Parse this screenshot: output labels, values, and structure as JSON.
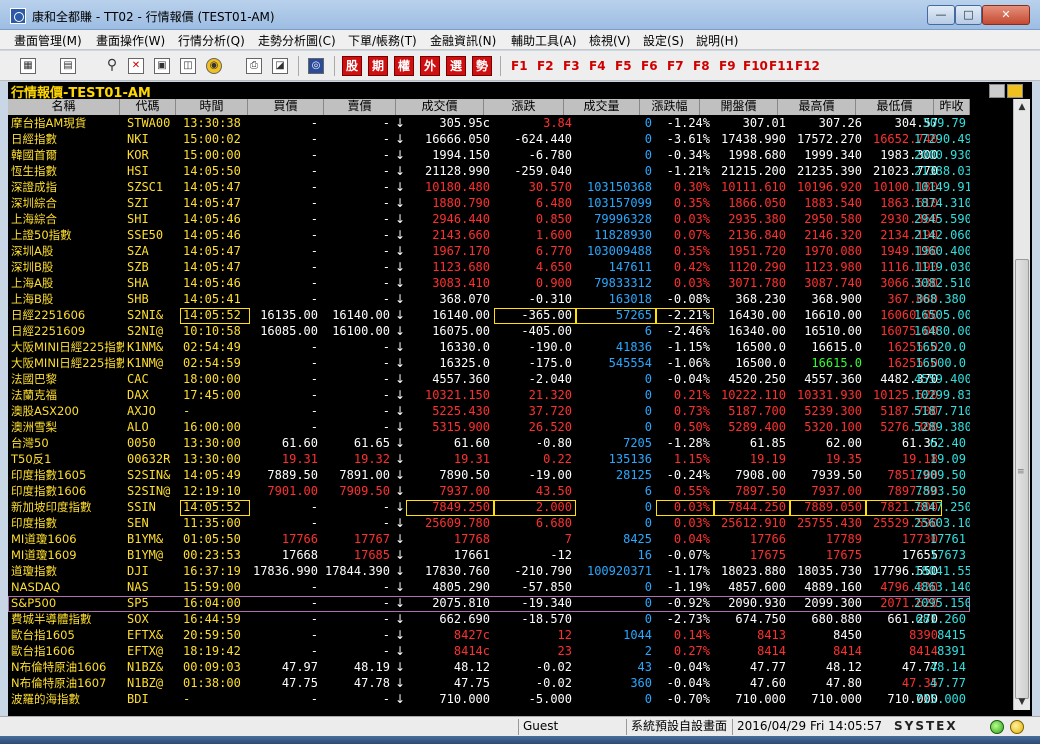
{
  "window": {
    "title": "康和全都賺 - TT02 - 行情報價 (TEST01-AM)",
    "min": "—",
    "max": "□",
    "close": "✕"
  },
  "menu": [
    "畫面管理(M)",
    "畫面操作(W)",
    "行情分析(Q)",
    "走勢分析圖(C)",
    "下單/帳務(T)",
    "金融資訊(N)",
    "輔助工具(A)",
    "檢視(V)",
    "設定(S)",
    "說明(H)"
  ],
  "toolbar": {
    "icons": [
      "layout-icon",
      "document-icon",
      "search-icon",
      "close-window-icon",
      "grid-icon",
      "news-icon",
      "globe-icon",
      "print-icon",
      "chart-icon",
      "logo-icon"
    ],
    "red_buttons": [
      "股",
      "期",
      "權",
      "外",
      "選",
      "勢"
    ],
    "fkeys": [
      "F1",
      "F2",
      "F3",
      "F4",
      "F5",
      "F6",
      "F7",
      "F8",
      "F9",
      "F10",
      "F11",
      "F12"
    ]
  },
  "panel": {
    "title": "行情報價-TEST01-AM"
  },
  "columns": [
    "名稱",
    "代碼",
    "時間",
    "買價",
    "賣價",
    "成交價",
    "漲跌",
    "成交量",
    "漲跌幅",
    "開盤價",
    "最高價",
    "最低價",
    "昨收"
  ],
  "rows": [
    [
      "摩台指AM現貨",
      "STWA00",
      "13:30:38",
      "-",
      "-",
      "305.95c",
      "3.84",
      "0",
      "-1.24%",
      "307.01",
      "307.26",
      "304.57",
      "309.79",
      "w",
      "r",
      "w",
      "w",
      "w",
      "c",
      "up"
    ],
    [
      "日經指數",
      "NKI",
      "15:00:02",
      "-",
      "-",
      "16666.050",
      "-624.440",
      "0",
      "-3.61%",
      "17438.990",
      "17572.270",
      "16652.740",
      "17290.490",
      "w",
      "w",
      "w",
      "w",
      "r",
      "c",
      "up"
    ],
    [
      "韓國首爾",
      "KOR",
      "15:00:00",
      "-",
      "-",
      "1994.150",
      "-6.780",
      "0",
      "-0.34%",
      "1998.680",
      "1999.340",
      "1983.300",
      "2000.930",
      "w",
      "w",
      "w",
      "w",
      "w",
      "c",
      "up"
    ],
    [
      "恆生指數",
      "HSI",
      "14:05:50",
      "-",
      "-",
      "21128.990",
      "-259.040",
      "0",
      "-1.21%",
      "21215.200",
      "21235.390",
      "21023.770",
      "21388.030",
      "w",
      "w",
      "w",
      "w",
      "w",
      "c",
      "up"
    ],
    [
      "深證成指",
      "SZSC1",
      "14:05:47",
      "-",
      "-",
      "10180.480",
      "30.570",
      "103150368",
      "0.30%",
      "10111.610",
      "10196.920",
      "10100.180",
      "10149.910",
      "r",
      "r",
      "r",
      "r",
      "r",
      "c",
      "up"
    ],
    [
      "深圳綜合",
      "SZI",
      "14:05:47",
      "-",
      "-",
      "1880.790",
      "6.480",
      "103157099",
      "0.35%",
      "1866.050",
      "1883.540",
      "1863.610",
      "1874.310",
      "r",
      "r",
      "r",
      "r",
      "r",
      "c",
      "up"
    ],
    [
      "上海綜合",
      "SHI",
      "14:05:46",
      "-",
      "-",
      "2946.440",
      "0.850",
      "79996328",
      "0.03%",
      "2935.380",
      "2950.580",
      "2930.360",
      "2945.590",
      "r",
      "r",
      "r",
      "r",
      "r",
      "c",
      "up"
    ],
    [
      "上證50指數",
      "SSE50",
      "14:05:46",
      "-",
      "-",
      "2143.660",
      "1.600",
      "11828930",
      "0.07%",
      "2136.840",
      "2146.320",
      "2134.190",
      "2142.060",
      "r",
      "r",
      "r",
      "r",
      "r",
      "c",
      "up"
    ],
    [
      "深圳A股",
      "SZA",
      "14:05:47",
      "-",
      "-",
      "1967.170",
      "6.770",
      "103009488",
      "0.35%",
      "1951.720",
      "1970.080",
      "1949.180",
      "1960.400",
      "r",
      "r",
      "r",
      "r",
      "r",
      "c",
      "up"
    ],
    [
      "深圳B股",
      "SZB",
      "14:05:47",
      "-",
      "-",
      "1123.680",
      "4.650",
      "147611",
      "0.42%",
      "1120.290",
      "1123.980",
      "1116.190",
      "1119.030",
      "r",
      "r",
      "r",
      "r",
      "r",
      "c",
      "dn"
    ],
    [
      "上海A股",
      "SHA",
      "14:05:46",
      "-",
      "-",
      "3083.410",
      "0.900",
      "79833312",
      "0.03%",
      "3071.780",
      "3087.740",
      "3066.530",
      "3082.510",
      "r",
      "r",
      "r",
      "r",
      "r",
      "c",
      "up"
    ],
    [
      "上海B股",
      "SHB",
      "14:05:41",
      "-",
      "-",
      "368.070",
      "-0.310",
      "163018",
      "-0.08%",
      "368.230",
      "368.900",
      "367.080",
      "368.380",
      "w",
      "w",
      "w",
      "w",
      "r",
      "c",
      "up"
    ],
    [
      "日經2251606",
      "S2NI&",
      "14:05:52",
      "16135.00",
      "16140.00",
      "16140.00",
      "-365.00",
      "57265",
      "-2.21%",
      "16430.00",
      "16610.00",
      "16060.00",
      "16505.00",
      "w",
      "w",
      "w",
      "w",
      "r",
      "c",
      "up"
    ],
    [
      "日經2251609",
      "S2NI@",
      "10:10:58",
      "16085.00",
      "16100.00",
      "16075.00",
      "-405.00",
      "6",
      "-2.46%",
      "16340.00",
      "16510.00",
      "16075.00",
      "16480.00",
      "w",
      "w",
      "w",
      "w",
      "r",
      "c",
      "dn"
    ],
    [
      "大阪MINI日經225指數",
      "K1NM&",
      "02:54:49",
      "-",
      "-",
      "16330.0",
      "-190.0",
      "41836",
      "-1.15%",
      "16500.0",
      "16615.0",
      "16255.0",
      "16520.0",
      "w",
      "w",
      "w",
      "w",
      "r",
      "c",
      "up"
    ],
    [
      "大阪MINI日經225指數",
      "K1NM@",
      "02:54:59",
      "-",
      "-",
      "16325.0",
      "-175.0",
      "545554",
      "-1.06%",
      "16500.0",
      "16615.0",
      "16255.0",
      "16500.0",
      "w",
      "w",
      "w",
      "g",
      "r",
      "c",
      "up"
    ],
    [
      "法國巴黎",
      "CAC",
      "18:00:00",
      "-",
      "-",
      "4557.360",
      "-2.040",
      "0",
      "-0.04%",
      "4520.250",
      "4557.360",
      "4482.370",
      "4559.400",
      "w",
      "w",
      "w",
      "w",
      "w",
      "c",
      "up"
    ],
    [
      "法蘭克福",
      "DAX",
      "17:45:00",
      "-",
      "-",
      "10321.150",
      "21.320",
      "0",
      "0.21%",
      "10222.110",
      "10331.930",
      "10125.520",
      "10299.830",
      "r",
      "r",
      "r",
      "r",
      "r",
      "c",
      "up"
    ],
    [
      "澳股ASX200",
      "AXJO",
      "-",
      "-",
      "-",
      "5225.430",
      "37.720",
      "0",
      "0.73%",
      "5187.700",
      "5239.300",
      "5187.700",
      "5187.710",
      "r",
      "r",
      "r",
      "r",
      "r",
      "c",
      "up"
    ],
    [
      "澳洲雪梨",
      "ALO",
      "16:00:00",
      "-",
      "-",
      "5315.900",
      "26.520",
      "0",
      "0.50%",
      "5289.400",
      "5320.100",
      "5276.300",
      "5289.380",
      "r",
      "r",
      "r",
      "r",
      "r",
      "c",
      "dn"
    ],
    [
      "台灣50",
      "0050",
      "13:30:00",
      "61.60",
      "61.65",
      "61.60",
      "-0.80",
      "7205",
      "-1.28%",
      "61.85",
      "62.00",
      "61.35",
      "62.40",
      "w",
      "w",
      "w",
      "w",
      "w",
      "c",
      "up"
    ],
    [
      "T50反1",
      "00632R",
      "13:30:00",
      "19.31",
      "19.32",
      "19.31",
      "0.22",
      "135136",
      "1.15%",
      "19.19",
      "19.35",
      "19.18",
      "19.09",
      "r",
      "r",
      "r",
      "r",
      "r",
      "c",
      "up"
    ],
    [
      "印度指數1605",
      "S2SIN&",
      "14:05:49",
      "7889.50",
      "7891.00",
      "7890.50",
      "-19.00",
      "28125",
      "-0.24%",
      "7908.00",
      "7939.50",
      "7851.00",
      "7909.50",
      "w",
      "w",
      "w",
      "w",
      "r",
      "c",
      "up"
    ],
    [
      "印度指數1606",
      "S2SIN@",
      "12:19:10",
      "7901.00",
      "7909.50",
      "7937.00",
      "43.50",
      "6",
      "0.55%",
      "7897.50",
      "7937.00",
      "7897.50",
      "7893.50",
      "r",
      "r",
      "r",
      "r",
      "r",
      "c",
      "up"
    ],
    [
      "新加坡印度指數",
      "SSIN",
      "14:05:52",
      "-",
      "-",
      "7849.250",
      "2.000",
      "0",
      "0.03%",
      "7844.250",
      "7889.050",
      "7821.800",
      "7847.250",
      "r",
      "r",
      "r",
      "r",
      "r",
      "c",
      "dn"
    ],
    [
      "印度指數",
      "SEN",
      "11:35:00",
      "-",
      "-",
      "25609.780",
      "6.680",
      "0",
      "0.03%",
      "25612.910",
      "25755.430",
      "25529.590",
      "25603.100",
      "r",
      "r",
      "r",
      "r",
      "r",
      "c",
      "dn"
    ],
    [
      "MI道瓊1606",
      "B1YM&",
      "01:05:50",
      "17766",
      "17767",
      "17768",
      "7",
      "8425",
      "0.04%",
      "17766",
      "17789",
      "17730",
      "17761",
      "r",
      "r",
      "r",
      "r",
      "r",
      "c",
      "up"
    ],
    [
      "MI道瓊1609",
      "B1YM@",
      "00:23:53",
      "17668",
      "17685",
      "17661",
      "-12",
      "16",
      "-0.07%",
      "17675",
      "17675",
      "17655",
      "17673",
      "w",
      "w",
      "r",
      "r",
      "w",
      "c",
      "up"
    ],
    [
      "道瓊指數",
      "DJI",
      "16:37:19",
      "17836.990",
      "17844.390",
      "17830.760",
      "-210.790",
      "100920371",
      "-1.17%",
      "18023.880",
      "18035.730",
      "17796.550",
      "18041.550",
      "w",
      "w",
      "w",
      "w",
      "w",
      "c",
      "up"
    ],
    [
      "NASDAQ",
      "NAS",
      "15:59:00",
      "-",
      "-",
      "4805.290",
      "-57.850",
      "0",
      "-1.19%",
      "4857.600",
      "4889.160",
      "4796.320",
      "4863.140",
      "w",
      "w",
      "w",
      "w",
      "r",
      "c",
      "dn"
    ],
    [
      "S&P500",
      "SP5",
      "16:04:00",
      "-",
      "-",
      "2075.810",
      "-19.340",
      "0",
      "-0.92%",
      "2090.930",
      "2099.300",
      "2071.620",
      "2095.150",
      "w",
      "w",
      "w",
      "w",
      "r",
      "c",
      "dn"
    ],
    [
      "費城半導體指數",
      "SOX",
      "16:44:59",
      "-",
      "-",
      "662.690",
      "-18.570",
      "0",
      "-2.73%",
      "674.750",
      "680.880",
      "661.270",
      "681.260",
      "w",
      "w",
      "w",
      "w",
      "w",
      "c",
      "up"
    ],
    [
      "歐台指1605",
      "EFTX&",
      "20:59:50",
      "-",
      "-",
      "8427c",
      "12",
      "1044",
      "0.14%",
      "8413",
      "8450",
      "8390",
      "8415",
      "r",
      "r",
      "r",
      "w",
      "r",
      "c",
      "dn"
    ],
    [
      "歐台指1606",
      "EFTX@",
      "18:19:42",
      "-",
      "-",
      "8414c",
      "23",
      "2",
      "0.27%",
      "8414",
      "8414",
      "8414",
      "8391",
      "r",
      "r",
      "r",
      "r",
      "r",
      "c",
      "up"
    ],
    [
      "N布倫特原油1606",
      "N1BZ&",
      "00:09:03",
      "47.97",
      "48.19",
      "48.12",
      "-0.02",
      "43",
      "-0.04%",
      "47.77",
      "48.12",
      "47.77",
      "48.14",
      "w",
      "w",
      "w",
      "w",
      "w",
      "c",
      "up"
    ],
    [
      "N布倫特原油1607",
      "N1BZ@",
      "01:38:00",
      "47.75",
      "47.78",
      "47.75",
      "-0.02",
      "360",
      "-0.04%",
      "47.60",
      "47.80",
      "47.35",
      "47.77",
      "w",
      "w",
      "w",
      "w",
      "r",
      "c",
      "up"
    ],
    [
      "波羅的海指數",
      "BDI",
      "-",
      "-",
      "-",
      "710.000",
      "-5.000",
      "0",
      "-0.70%",
      "710.000",
      "710.000",
      "710.000",
      "715.000",
      "w",
      "w",
      "w",
      "w",
      "w",
      "c",
      "up"
    ]
  ],
  "status": {
    "user": "Guest",
    "screen": "系統預設自設畫面",
    "datetime": "2016/04/29 Fri 14:05:57",
    "brand": "SYSTEX"
  }
}
